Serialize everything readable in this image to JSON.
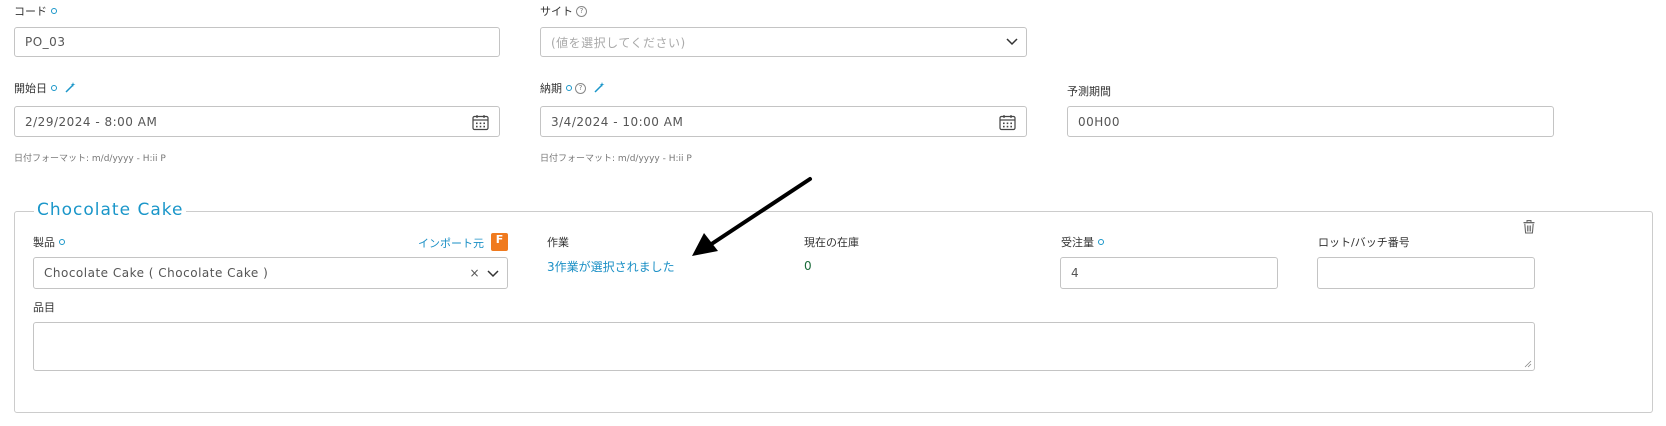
{
  "code": {
    "label": "コード",
    "value": "PO_03"
  },
  "site": {
    "label": "サイト",
    "placeholder": "(値を選択してください)"
  },
  "start_date": {
    "label": "開始日",
    "value": "2/29/2024 - 8:00 AM",
    "hint": "日付フォーマット: m/d/yyyy - H:ii P"
  },
  "due_date": {
    "label": "納期",
    "value": "3/4/2024 - 10:00 AM",
    "hint": "日付フォーマット: m/d/yyyy - H:ii P"
  },
  "forecast_period": {
    "label": "予測期間",
    "value": "00H00"
  },
  "section": {
    "title": "Chocolate Cake",
    "product": {
      "label": "製品",
      "import_link": "インポート元",
      "import_badge": "F",
      "value": "Chocolate Cake ( Chocolate Cake )"
    },
    "operation": {
      "label": "作業",
      "value": "3作業が選択されました"
    },
    "stock": {
      "label": "現在の在庫",
      "value": "0"
    },
    "order_qty": {
      "label": "受注量",
      "value": "4"
    },
    "lot": {
      "label": "ロット/バッチ番号",
      "value": ""
    },
    "items": {
      "label": "品目",
      "value": ""
    }
  },
  "colors": {
    "accent": "#1a96c9",
    "border": "#c4c4c4",
    "badge": "#f07a1e"
  }
}
